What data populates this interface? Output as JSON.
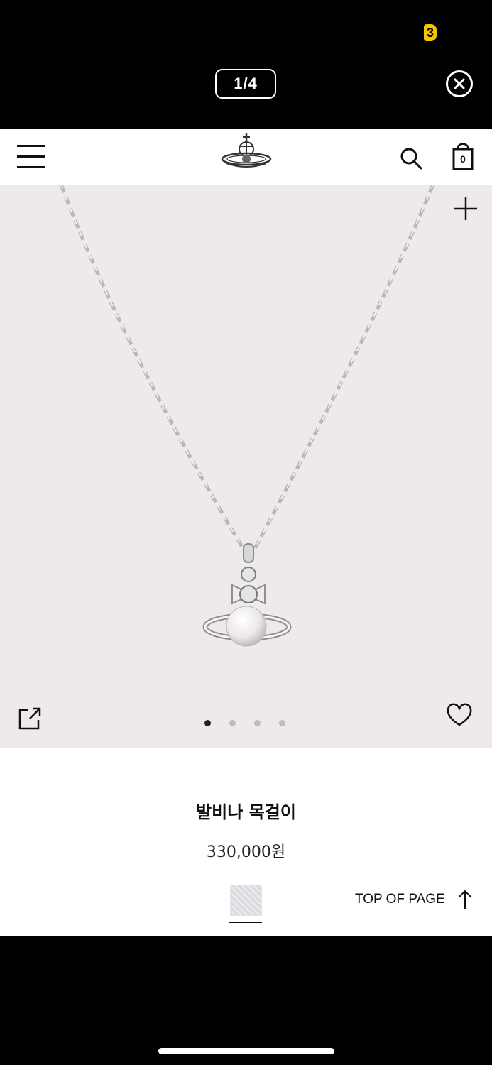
{
  "viewer": {
    "status_badge": "3",
    "page_counter": "1/4",
    "close_icon": "close-circle-icon"
  },
  "header": {
    "menu_icon": "hamburger-menu-icon",
    "logo_icon": "orb-logo-icon",
    "search_icon": "search-icon",
    "bag_icon": "shopping-bag-icon",
    "bag_count": "0"
  },
  "gallery": {
    "image_description": "silver orb pendant with pearl on chain",
    "zoom_icon": "plus-icon",
    "share_icon": "share-icon",
    "wishlist_icon": "heart-icon",
    "slide_count": 4,
    "active_slide": 1
  },
  "product": {
    "name": "발비나 목걸이",
    "price": "330,000원"
  },
  "footer": {
    "top_of_page": "TOP OF PAGE",
    "top_icon": "arrow-up-icon"
  }
}
